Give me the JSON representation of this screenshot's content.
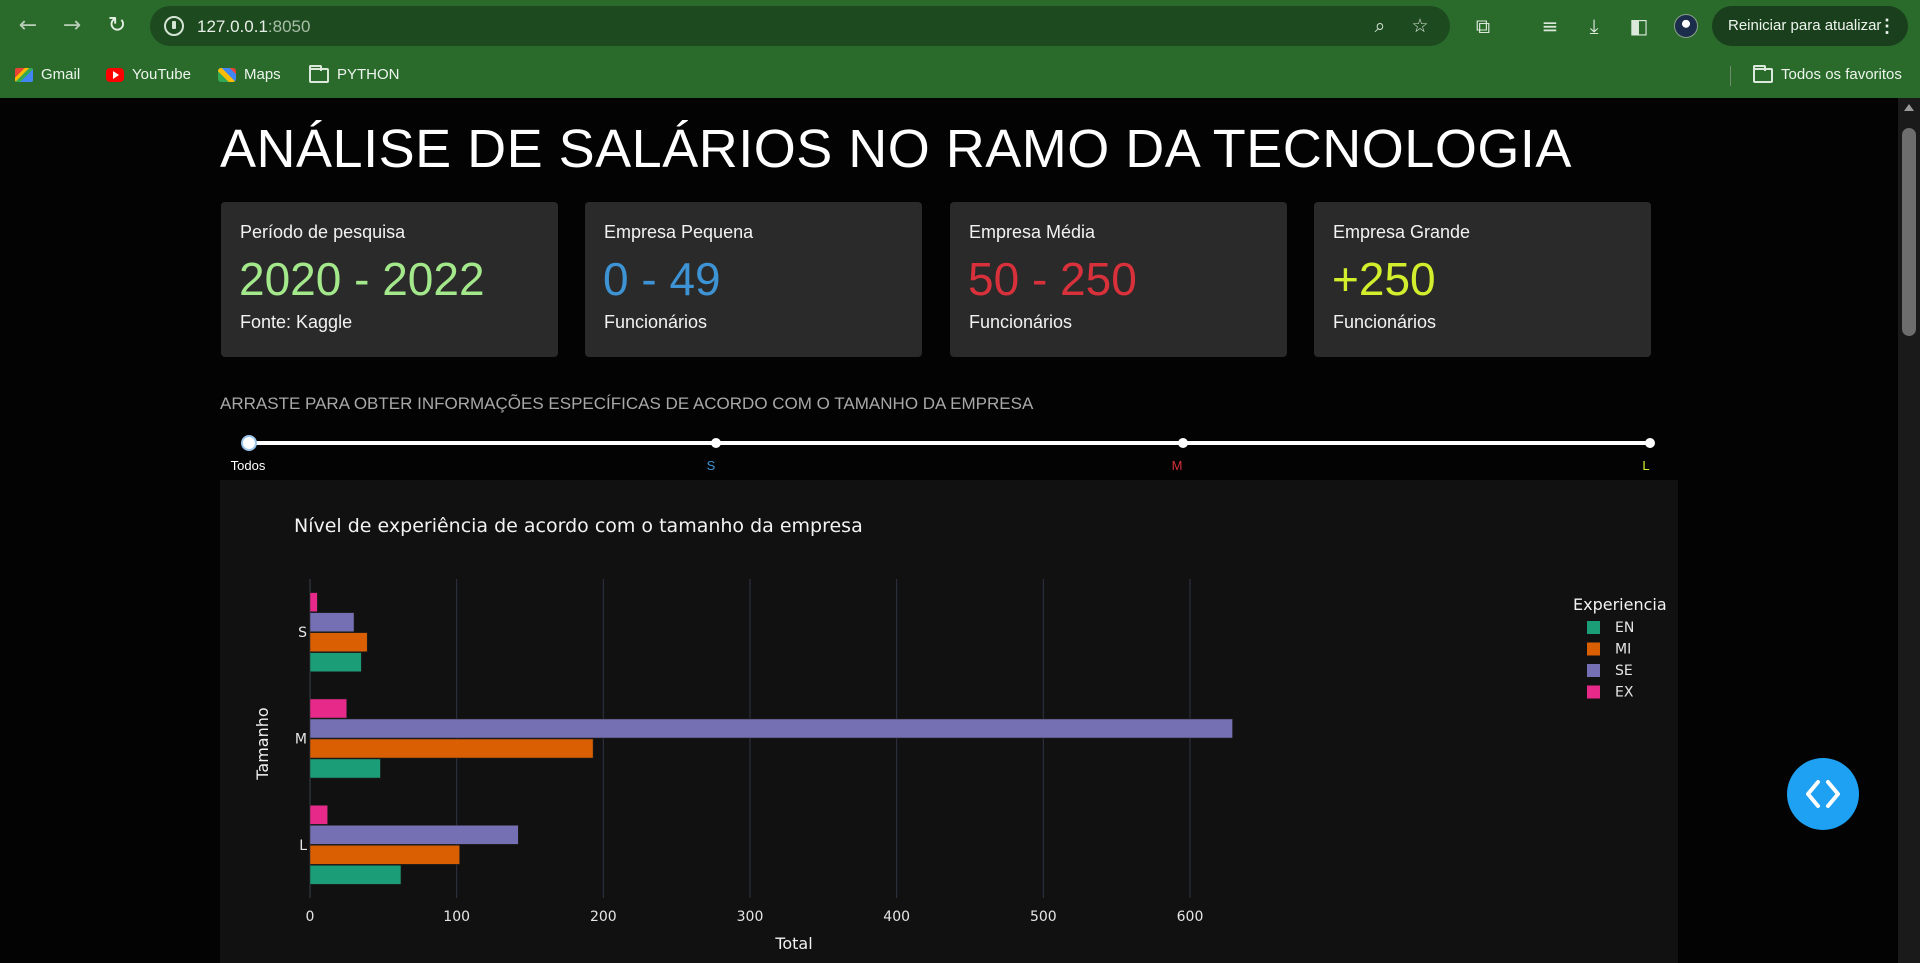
{
  "browser": {
    "url_host": "127.0.0.1",
    "url_port": ":8050",
    "restart_label": "Reiniciar para atualizar",
    "bookmarks": [
      "Gmail",
      "YouTube",
      "Maps",
      "PYTHON"
    ],
    "all_bookmarks_label": "Todos os favoritos"
  },
  "header": {
    "title": "ANÁLISE DE SALÁRIOS NO RAMO DA TECNOLOGIA"
  },
  "cards": [
    {
      "label": "Período de pesquisa",
      "value": "2020 - 2022",
      "foot": "Fonte: Kaggle",
      "color": "#a3e88a"
    },
    {
      "label": "Empresa Pequena",
      "value": "0 - 49",
      "foot": "Funcionários",
      "color": "#3d93d3"
    },
    {
      "label": "Empresa Média",
      "value": "50 - 250",
      "foot": "Funcionários",
      "color": "#d8313b"
    },
    {
      "label": "Empresa Grande",
      "value": "+250",
      "foot": "Funcionários",
      "color": "#d2ee2c"
    }
  ],
  "slider": {
    "caption": "ARRASTE PARA OBTER INFORMAÇÕES ESPECÍFICAS DE ACORDO COM O TAMANHO DA EMPRESA",
    "marks": [
      {
        "label": "Todos",
        "color": "#ffffff"
      },
      {
        "label": "S",
        "color": "#3d93d3"
      },
      {
        "label": "M",
        "color": "#d8313b"
      },
      {
        "label": "L",
        "color": "#d2ee2c"
      }
    ],
    "selected": "Todos"
  },
  "chart_data": {
    "type": "bar",
    "orientation": "horizontal",
    "title": "Nível de experiência de acordo com o tamanho da empresa",
    "xlabel": "Total",
    "ylabel": "Tamanho",
    "categories": [
      "S",
      "M",
      "L"
    ],
    "xlim": [
      0,
      660
    ],
    "xticks": [
      0,
      100,
      200,
      300,
      400,
      500,
      600
    ],
    "legend_title": "Experiencia",
    "legend_position": "top-right",
    "grid": true,
    "series": [
      {
        "name": "EN",
        "color": "#1b9e77",
        "values": [
          35,
          48,
          62
        ]
      },
      {
        "name": "MI",
        "color": "#d95f02",
        "values": [
          39,
          193,
          102
        ]
      },
      {
        "name": "SE",
        "color": "#7570b3",
        "values": [
          30,
          629,
          142
        ]
      },
      {
        "name": "EX",
        "color": "#e7298a",
        "values": [
          5,
          25,
          12
        ]
      }
    ]
  },
  "icons": {
    "back": "arrow-left-icon",
    "forward": "arrow-right-icon",
    "reload": "reload-icon",
    "fab": "code-brackets-icon"
  }
}
